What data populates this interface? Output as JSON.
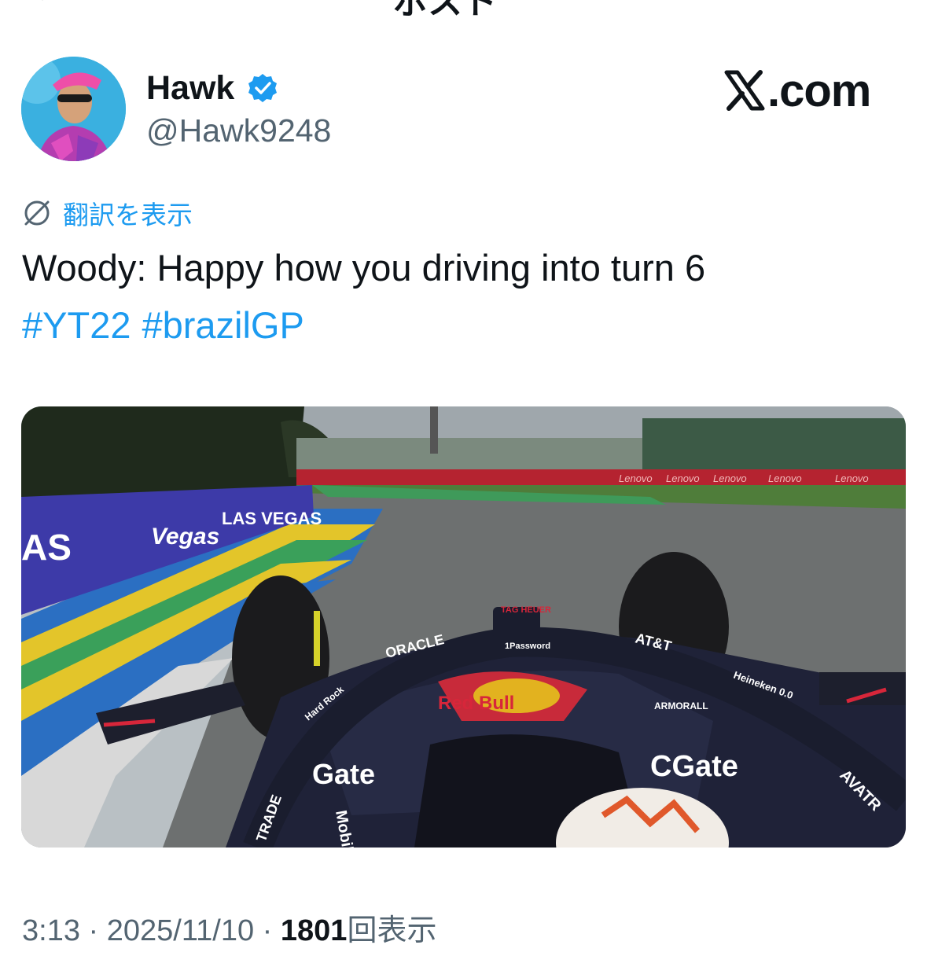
{
  "header": {
    "title": "ポスト"
  },
  "author": {
    "display_name": "Hawk",
    "handle": "@Hawk9248",
    "verified": true,
    "verified_color": "#1d9bf0"
  },
  "brand": {
    "label": ".com",
    "icon": "x-logo-icon"
  },
  "translate": {
    "label": "翻訳を表示",
    "icon": "globe-icon"
  },
  "tweet": {
    "text": "Woody: Happy how you driving into turn 6",
    "hashtags": [
      "#YT22",
      "#brazilGP"
    ]
  },
  "media": {
    "type": "video-still",
    "sponsors": [
      "LAS VEGAS",
      "Lenovo",
      "ORACLE",
      "1Password",
      "AT&T",
      "Red Bull",
      "Heineken 0.0",
      "Gate",
      "Mobil",
      "Hard Rock",
      "AVATR",
      "ARMORALL",
      "TAG HEUER"
    ]
  },
  "meta": {
    "time": "3:13",
    "sep1": " · ",
    "date": "2025/11/10",
    "sep2": " · ",
    "views_count": "1801",
    "views_label": "回表示"
  },
  "colors": {
    "link": "#1d9bf0",
    "muted": "#536471",
    "text": "#0f1419"
  }
}
